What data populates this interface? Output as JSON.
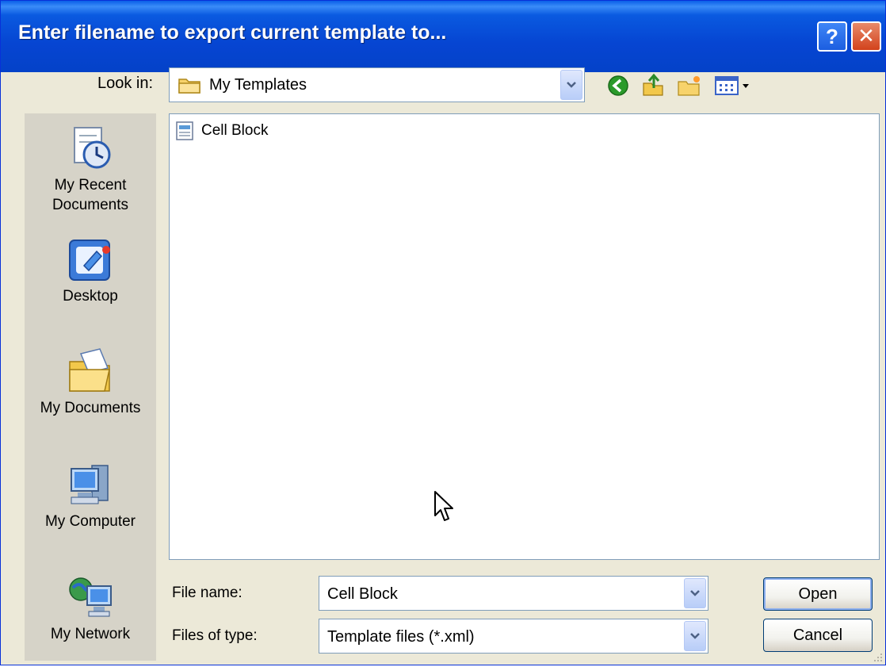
{
  "dialog": {
    "title": "Enter filename to export current template to...",
    "help_label": "?",
    "close_label": "✕"
  },
  "lookin": {
    "label": "Look in:",
    "value": "My Templates"
  },
  "toolbar": {
    "icons": [
      "back-icon",
      "up-folder-icon",
      "new-folder-icon",
      "views-menu-icon"
    ]
  },
  "places": [
    {
      "label_lines": [
        "My Recent",
        "Documents"
      ],
      "icon": "recent-documents-icon"
    },
    {
      "label_lines": [
        "Desktop"
      ],
      "icon": "desktop-icon"
    },
    {
      "label_lines": [
        "My Documents"
      ],
      "icon": "my-documents-icon"
    },
    {
      "label_lines": [
        "My Computer"
      ],
      "icon": "my-computer-icon"
    },
    {
      "label_lines": [
        "My Network"
      ],
      "icon": "my-network-icon"
    }
  ],
  "files": [
    {
      "name": "Cell Block",
      "icon": "template-file-icon"
    }
  ],
  "filename": {
    "label": "File name:",
    "value": "Cell Block"
  },
  "filetype": {
    "label": "Files of type:",
    "value": "Template files (*.xml)"
  },
  "buttons": {
    "open": "Open",
    "cancel": "Cancel"
  },
  "colors": {
    "titlebar": "#0a5ae0",
    "dialog_bg": "#ece9d8",
    "places_bg": "#d6d3c8",
    "field_border": "#7f9db9"
  }
}
